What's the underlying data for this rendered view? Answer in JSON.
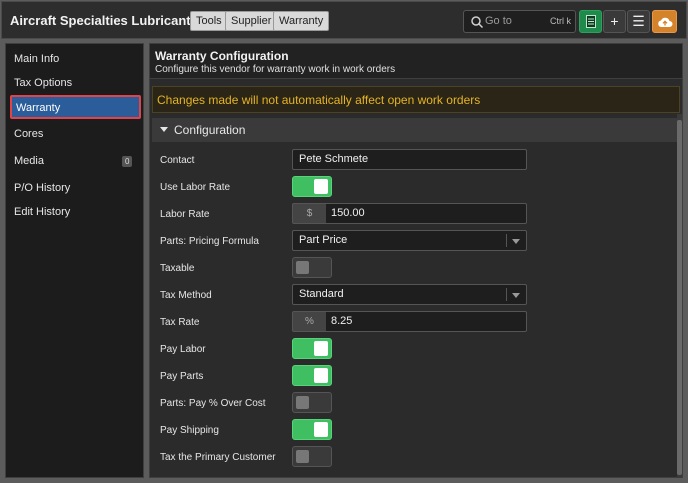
{
  "header": {
    "company": "Aircraft Specialties Lubricants, LLC",
    "tags": [
      "Tools",
      "Supplier",
      "Warranty"
    ],
    "goto_placeholder": "Go to",
    "goto_shortcut": "Ctrl k",
    "icons": [
      "search-icon",
      "spreadsheet-icon",
      "plus-icon",
      "menu-icon",
      "cloud-upload-icon"
    ]
  },
  "sidebar": {
    "items": [
      {
        "label": "Main Info"
      },
      {
        "label": "Tax Options"
      },
      {
        "label": "Warranty"
      },
      {
        "label": "Cores"
      },
      {
        "label": "Media",
        "badge": "0"
      },
      {
        "label": "P/O History"
      },
      {
        "label": "Edit History"
      }
    ]
  },
  "main": {
    "title": "Warranty Configuration",
    "subtitle": "Configure this vendor for warranty work in work orders",
    "warning": "Changes made will not automatically affect open work orders",
    "section_title": "Configuration",
    "fields": {
      "contact": {
        "label": "Contact",
        "value": "Pete Schmete"
      },
      "use_labor_rate": {
        "label": "Use Labor Rate",
        "on": true
      },
      "labor_rate": {
        "label": "Labor Rate",
        "prefix": "$",
        "value": "150.00"
      },
      "pricing_formula": {
        "label": "Parts: Pricing Formula",
        "value": "Part Price"
      },
      "taxable": {
        "label": "Taxable",
        "on": false
      },
      "tax_method": {
        "label": "Tax Method",
        "value": "Standard"
      },
      "tax_rate": {
        "label": "Tax Rate",
        "prefix": "%",
        "value": "8.25"
      },
      "pay_labor": {
        "label": "Pay Labor",
        "on": true
      },
      "pay_parts": {
        "label": "Pay Parts",
        "on": true
      },
      "pay_pct_over_cost": {
        "label": "Parts: Pay % Over Cost",
        "on": false
      },
      "pay_shipping": {
        "label": "Pay Shipping",
        "on": true
      },
      "tax_primary_customer": {
        "label": "Tax the Primary Customer",
        "on": false
      }
    }
  },
  "colors": {
    "accent_active": "#2a5d99",
    "highlight_border": "#e0444a",
    "toggle_on": "#3fbf62",
    "warning_text": "#e6b422",
    "button_green": "#1f8a4c",
    "button_orange": "#d4832a"
  }
}
